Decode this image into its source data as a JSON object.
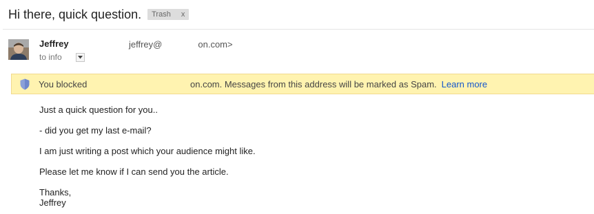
{
  "subject": "Hi there, quick question.",
  "label": {
    "name": "Trash",
    "remove": "x"
  },
  "sender": {
    "name": "Jeffrey",
    "email_start": "jeffrey@",
    "email_end": "on.com>"
  },
  "recipient": {
    "to": "to info"
  },
  "banner": {
    "message_start": "You blocked",
    "message_end": "on.com. Messages from this address will be marked as Spam.",
    "learn_more": "Learn more"
  },
  "body": {
    "lines": [
      "Just a quick question for you..",
      "- did you get my last e-mail?",
      "I am just writing a post which your audience might like.",
      "Please let me know if I can send you the article."
    ],
    "closing": "Thanks,",
    "signature": "Jeffrey"
  },
  "icons": {
    "avatar": "profile-photo",
    "dropdown": "chevron-down-icon",
    "banner": "shield-icon"
  },
  "colors": {
    "banner_bg": "#fff3b0",
    "banner_border": "#f1d98e",
    "link": "#1155cc",
    "shield": "#8aa0d8"
  }
}
